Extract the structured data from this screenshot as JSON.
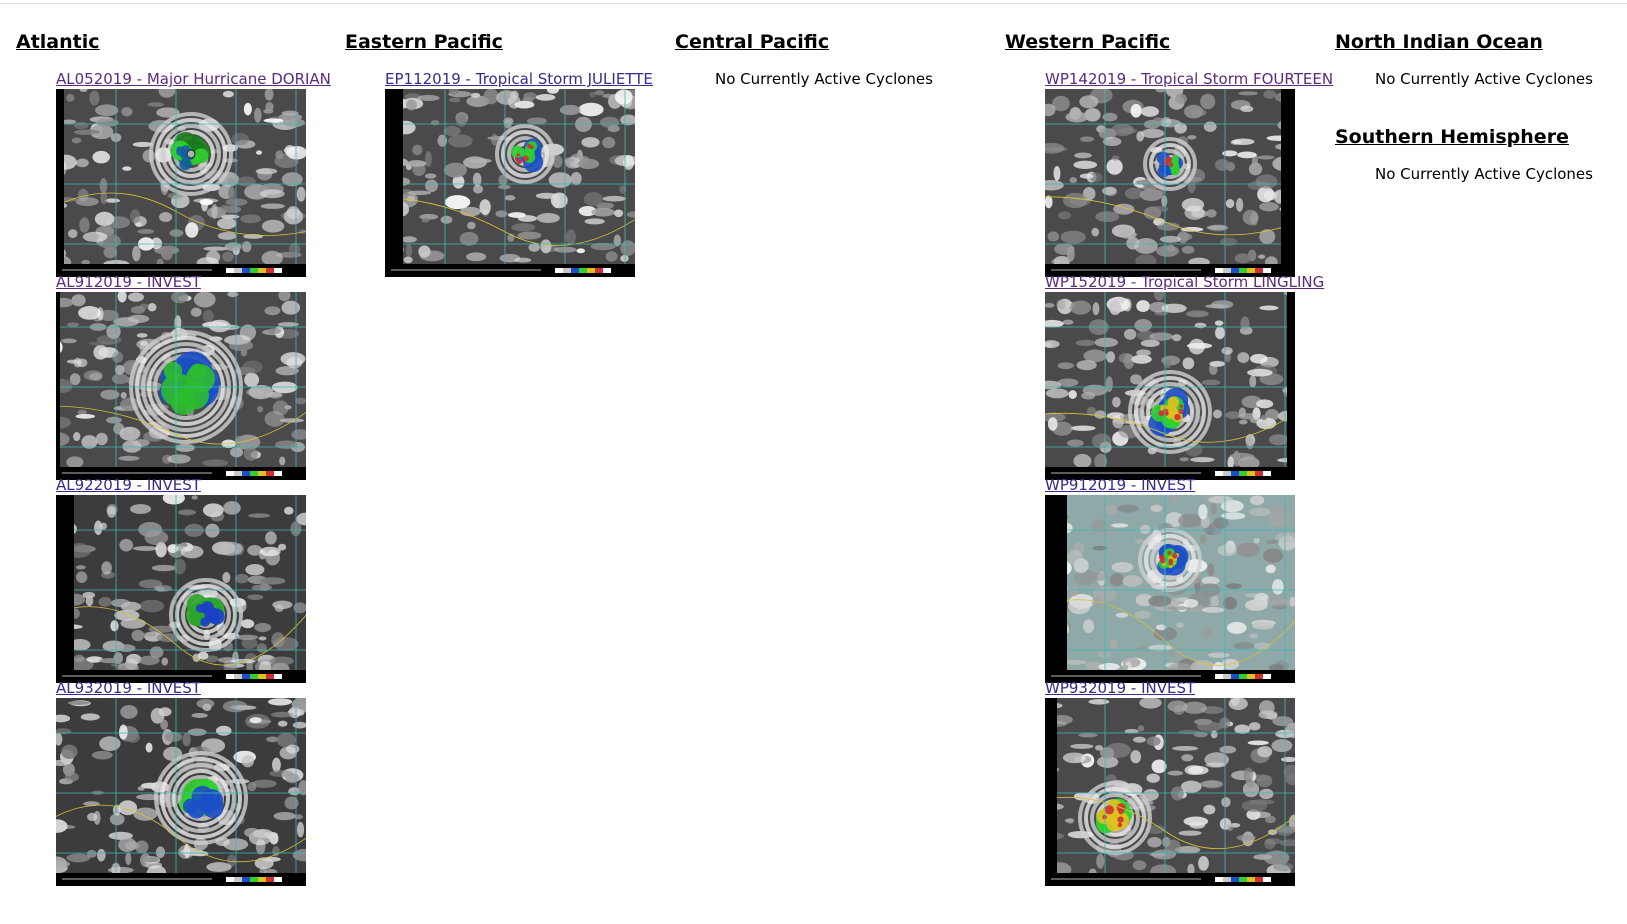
{
  "columns": [
    {
      "heading": "Atlantic",
      "storms": [
        {
          "label": "AL052019 - Major Hurricane DORIAN",
          "visited": true,
          "image_icon": "satellite-image"
        },
        {
          "label": "AL912019 - INVEST",
          "visited": true,
          "image_icon": "satellite-image"
        },
        {
          "label": "AL922019 - INVEST",
          "visited": false,
          "image_icon": "satellite-image"
        },
        {
          "label": "AL932019 - INVEST",
          "visited": false,
          "image_icon": "satellite-image"
        }
      ]
    },
    {
      "heading": "Eastern Pacific",
      "storms": [
        {
          "label": "EP112019 - Tropical Storm JULIETTE",
          "visited": false,
          "image_icon": "satellite-image"
        }
      ]
    },
    {
      "heading": "Central Pacific",
      "message": "No Currently Active Cyclones"
    },
    {
      "heading": "Western Pacific",
      "storms": [
        {
          "label": "WP142019 - Tropical Storm FOURTEEN",
          "visited": true,
          "image_icon": "satellite-image"
        },
        {
          "label": "WP152019 - Tropical Storm LINGLING",
          "visited": true,
          "image_icon": "satellite-image"
        },
        {
          "label": "WP912019 - INVEST",
          "visited": false,
          "image_icon": "satellite-image"
        },
        {
          "label": "WP932019 - INVEST",
          "visited": false,
          "image_icon": "satellite-image"
        }
      ]
    },
    {
      "heading": "North Indian Ocean",
      "message": "No Currently Active Cyclones"
    },
    {
      "heading": "Southern Hemisphere",
      "message": "No Currently Active Cyclones"
    }
  ],
  "colors": {
    "link": "#3a2a8c",
    "link_visited": "#5c2a7e",
    "grid_line": "#3fb8b8",
    "coast": "#d8c23a"
  }
}
